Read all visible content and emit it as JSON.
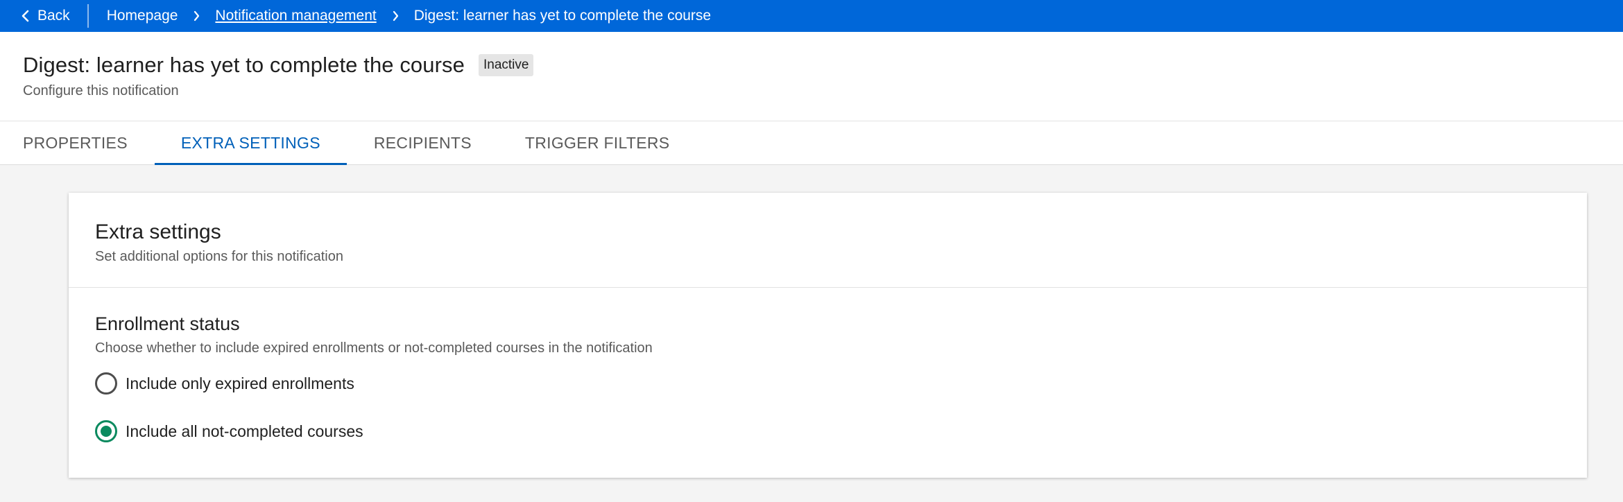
{
  "breadcrumb": {
    "back": "Back",
    "items": [
      {
        "label": "Homepage",
        "link": false
      },
      {
        "label": "Notification management",
        "link": true
      },
      {
        "label": "Digest: learner has yet to complete the course",
        "link": false
      }
    ]
  },
  "header": {
    "title": "Digest: learner has yet to complete the course",
    "status": "Inactive",
    "subtitle": "Configure this notification"
  },
  "tabs": [
    {
      "label": "PROPERTIES",
      "active": false
    },
    {
      "label": "EXTRA SETTINGS",
      "active": true
    },
    {
      "label": "RECIPIENTS",
      "active": false
    },
    {
      "label": "TRIGGER FILTERS",
      "active": false
    }
  ],
  "card": {
    "title": "Extra settings",
    "subtitle": "Set additional options for this notification",
    "section": {
      "title": "Enrollment status",
      "subtitle": "Choose whether to include expired enrollments or not-completed courses in the notification",
      "options": [
        {
          "label": "Include only expired enrollments",
          "selected": false
        },
        {
          "label": "Include all not-completed courses",
          "selected": true
        }
      ]
    }
  },
  "colors": {
    "topbar": "#0067d9",
    "active_tab": "#0060b9",
    "radio_selected": "#0b8a5f"
  }
}
